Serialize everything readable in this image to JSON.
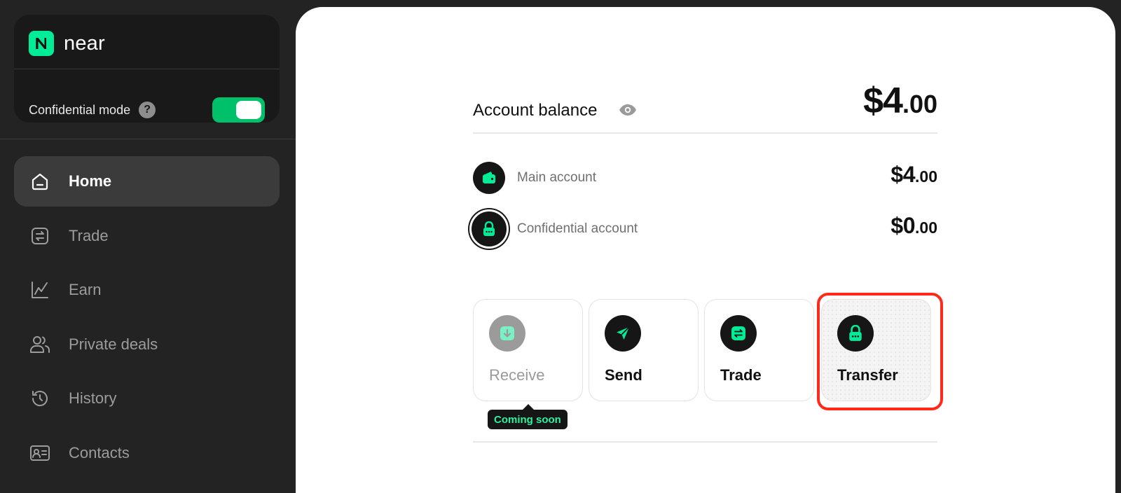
{
  "sidebar": {
    "brand": {
      "name": "near",
      "logo_color": "#00ec97"
    },
    "confidential_mode": {
      "label": "Confidential mode",
      "help_icon": "?",
      "enabled": true
    },
    "nav": [
      {
        "label": "Home",
        "icon": "home-icon",
        "active": true
      },
      {
        "label": "Trade",
        "icon": "trade-icon",
        "active": false
      },
      {
        "label": "Earn",
        "icon": "chart-line-icon",
        "active": false
      },
      {
        "label": "Private deals",
        "icon": "users-icon",
        "active": false
      },
      {
        "label": "History",
        "icon": "history-icon",
        "active": false
      },
      {
        "label": "Contacts",
        "icon": "contact-card-icon",
        "active": false
      }
    ]
  },
  "main": {
    "balance": {
      "label": "Account balance",
      "int": "$4",
      "dec": ".00"
    },
    "accounts": [
      {
        "name": "Main account",
        "int": "$4",
        "dec": ".00",
        "icon": "wallet-icon"
      },
      {
        "name": "Confidential account",
        "int": "$0",
        "dec": ".00",
        "icon": "lock-icon"
      }
    ],
    "actions": [
      {
        "label": "Receive",
        "icon": "receive-icon",
        "disabled": true
      },
      {
        "label": "Send",
        "icon": "send-icon",
        "disabled": false
      },
      {
        "label": "Trade",
        "icon": "trade-icon",
        "disabled": false
      },
      {
        "label": "Transfer",
        "icon": "lock-icon",
        "disabled": false,
        "highlighted": true
      }
    ],
    "tooltip": "Coming soon"
  },
  "colors": {
    "accent": "#00ec97",
    "toggle_on": "#00c16a",
    "highlight": "#ff2a1a"
  }
}
